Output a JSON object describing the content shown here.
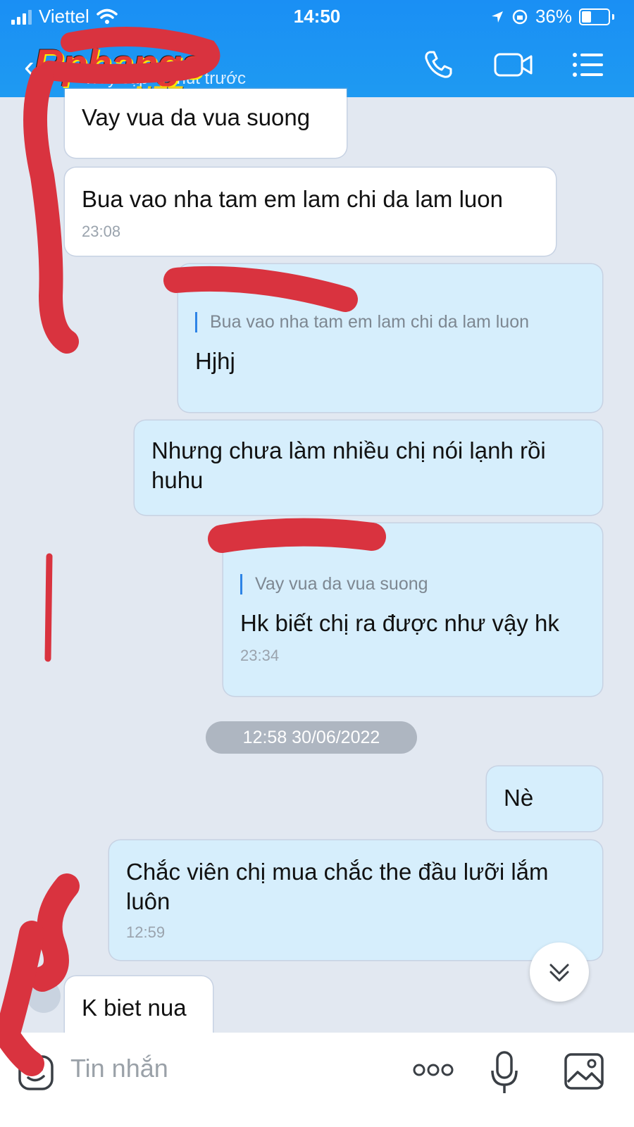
{
  "status_bar": {
    "carrier": "Viettel",
    "time": "14:50",
    "battery": "36%"
  },
  "header": {
    "last_seen": "Truy cập 4 phút trước",
    "watermark_main": "Rphangs",
    "watermark_sub": ".NET",
    "icons": [
      "phone-icon",
      "video-call-icon",
      "menu-list-icon"
    ]
  },
  "messages": [
    {
      "side": "in",
      "text": "Vay vua da vua suong"
    },
    {
      "side": "in",
      "text": "Bua vao nha tam em lam chi da lam luon",
      "time": "23:08"
    },
    {
      "side": "out",
      "quote": "Bua vao nha tam em lam chi da lam luon",
      "text": "Hjhj"
    },
    {
      "side": "out",
      "text": "Nhưng chưa làm nhiều chị nói lạnh rồi huhu"
    },
    {
      "side": "out",
      "quote": "Vay vua da vua suong",
      "text": "Hk biết chị ra được như vậy hk",
      "time": "23:34"
    },
    {
      "side": "out",
      "text": "Nè"
    },
    {
      "side": "out",
      "text": "Chắc viên chị mua chắc the đầu lưỡi lắm luôn",
      "time": "12:59"
    },
    {
      "side": "in",
      "text": "K biet nua"
    }
  ],
  "date_divider": "12:58 30/06/2022",
  "composer": {
    "placeholder": "Tin nhắn",
    "icons": [
      "sticker-icon",
      "more-icon",
      "microphone-icon",
      "image-icon"
    ]
  },
  "colors": {
    "header": "#1e9af2",
    "incoming": "#ffffff",
    "outgoing": "#d6eefc",
    "background": "#e2e8f1",
    "redaction": "#d9333f"
  }
}
